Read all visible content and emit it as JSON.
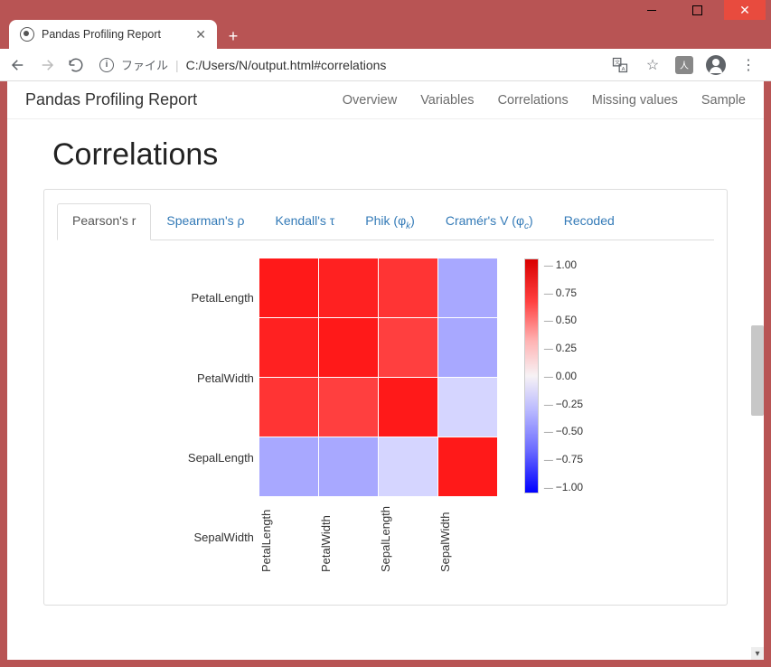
{
  "window": {
    "tab_title": "Pandas Profiling Report",
    "file_label": "ファイル",
    "url": "C:/Users/N/output.html#correlations"
  },
  "nav": {
    "brand": "Pandas Profiling Report",
    "links": [
      "Overview",
      "Variables",
      "Correlations",
      "Missing values",
      "Sample"
    ]
  },
  "section_title": "Correlations",
  "tabs": {
    "items": [
      {
        "label": "Pearson's r",
        "active": true
      },
      {
        "label": "Spearman's ρ",
        "active": false
      },
      {
        "label": "Kendall's τ",
        "active": false
      },
      {
        "label": "Phik (φ",
        "sub": "k",
        "suffix": ")",
        "active": false
      },
      {
        "label": "Cramér's V (φ",
        "sub": "c",
        "suffix": ")",
        "active": false
      },
      {
        "label": "Recoded",
        "active": false
      }
    ]
  },
  "chart_data": {
    "type": "heatmap",
    "title": "",
    "x_labels": [
      "PetalLength",
      "PetalWidth",
      "SepalLength",
      "SepalWidth"
    ],
    "y_labels": [
      "PetalLength",
      "PetalWidth",
      "SepalLength",
      "SepalWidth"
    ],
    "matrix": [
      [
        1.0,
        0.96,
        0.87,
        -0.37
      ],
      [
        0.96,
        1.0,
        0.82,
        -0.37
      ],
      [
        0.87,
        0.82,
        1.0,
        -0.12
      ],
      [
        -0.37,
        -0.37,
        -0.12,
        1.0
      ]
    ],
    "colorbar": {
      "min": -1.0,
      "max": 1.0,
      "ticks": [
        "1.00",
        "0.75",
        "0.50",
        "0.25",
        "0.00",
        "−0.25",
        "−0.50",
        "−0.75",
        "−1.00"
      ]
    }
  }
}
